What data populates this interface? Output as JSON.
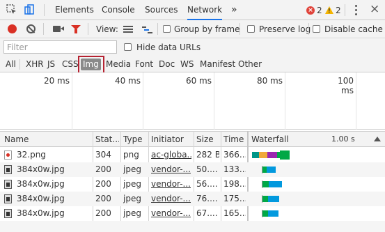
{
  "tabs": {
    "items": [
      "Elements",
      "Console",
      "Sources",
      "Network"
    ],
    "active": "Network",
    "more": "»"
  },
  "status": {
    "errors": "2",
    "warnings": "2",
    "close": "×"
  },
  "toolbar": {
    "view_label": "View:",
    "group_by_frame": "Group by frame",
    "preserve_log": "Preserve log",
    "disable_cache": "Disable cache"
  },
  "filter": {
    "placeholder": "Filter",
    "hide_data_urls": "Hide data URLs"
  },
  "types": [
    "All",
    "XHR",
    "JS",
    "CSS",
    "Img",
    "Media",
    "Font",
    "Doc",
    "WS",
    "Manifest",
    "Other"
  ],
  "selected_type": "Img",
  "overview": {
    "ticks": [
      "20 ms",
      "40 ms",
      "60 ms",
      "80 ms",
      "100 ms"
    ]
  },
  "table": {
    "columns": [
      "Name",
      "Stat...",
      "Type",
      "Initiator",
      "Size",
      "Time",
      "Waterfall"
    ],
    "waterfall_scale": "1.00 s",
    "rows": [
      {
        "name": "32.png",
        "status": "304",
        "type": "png",
        "initiator": "ac-globa...",
        "size": "282 B",
        "time": "366..."
      },
      {
        "name": "384x0w.jpg",
        "status": "200",
        "type": "jpeg",
        "initiator": "vendor-...",
        "size": "50....",
        "time": "133..."
      },
      {
        "name": "384x0w.jpg",
        "status": "200",
        "type": "jpeg",
        "initiator": "vendor-...",
        "size": "56....",
        "time": "198..."
      },
      {
        "name": "384x0w.jpg",
        "status": "200",
        "type": "jpeg",
        "initiator": "vendor-...",
        "size": "76....",
        "time": "175..."
      },
      {
        "name": "384x0w.jpg",
        "status": "200",
        "type": "jpeg",
        "initiator": "vendor-...",
        "size": "67....",
        "time": "165..."
      }
    ]
  },
  "colors": {
    "record": "#d93025",
    "filter_active": "#d93025",
    "active_tab_underline": "#1a73e8",
    "highlight_box": "#b52231",
    "waterfall_waiting": "#00a846",
    "waterfall_download": "#0299de",
    "waterfall_dns": "#f0a93b",
    "waterfall_ssl": "#9c27b0",
    "waterfall_stalled": "#009688"
  }
}
